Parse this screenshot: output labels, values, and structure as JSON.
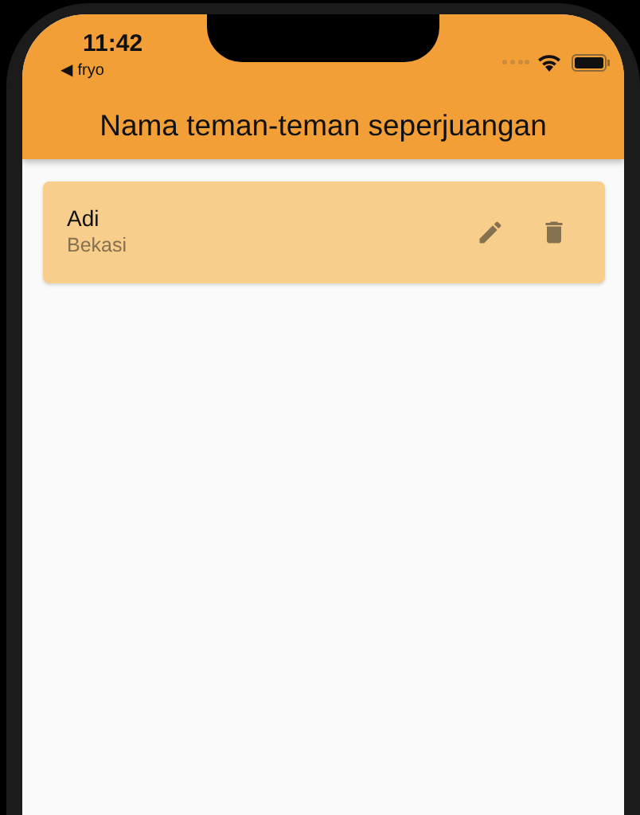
{
  "status_bar": {
    "time": "11:42",
    "back_label": "◀ fryo"
  },
  "app_bar": {
    "title": "Nama teman-teman seperjuangan"
  },
  "friends": [
    {
      "name": "Adi",
      "city": "Bekasi"
    }
  ]
}
